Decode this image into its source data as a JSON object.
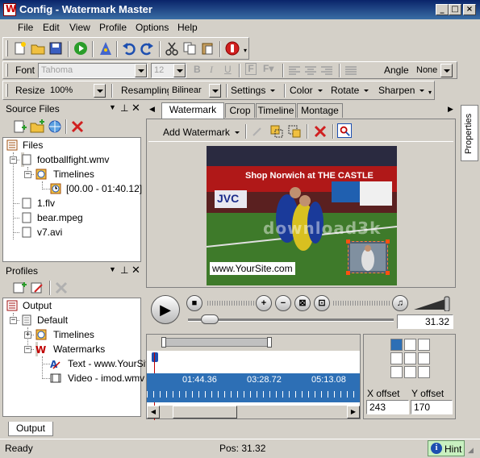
{
  "window": {
    "title": "Config - Watermark Master"
  },
  "menu": [
    "File",
    "Edit",
    "View",
    "Profile",
    "Options",
    "Help"
  ],
  "format_toolbar": {
    "font_label": "Font",
    "font_value": "Tahoma",
    "size_value": "12",
    "angle_label": "Angle",
    "angle_value": "None"
  },
  "process_toolbar": {
    "resize_label": "Resize",
    "resize_value": "100%",
    "resampling_label": "Resampling",
    "resampling_value": "Bilinear",
    "settings_label": "Settings",
    "color_label": "Color",
    "rotate_label": "Rotate",
    "sharpen_label": "Sharpen"
  },
  "source_files": {
    "title": "Source Files",
    "root": "Files",
    "items": {
      "football": "footballfight.wmv",
      "timelines": "Timelines",
      "range": "[00.00 - 01:40.12]",
      "flv": "1.flv",
      "mpeg": "bear.mpeg",
      "avi": "v7.avi"
    }
  },
  "profiles": {
    "title": "Profiles",
    "root": "Output",
    "default": "Default",
    "timelines": "Timelines",
    "watermarks": "Watermarks",
    "text_wm": "Text - www.YourSit",
    "video_wm": "Video - imod.wmv"
  },
  "tabs": [
    "Watermark",
    "Crop",
    "Timeline",
    "Montage"
  ],
  "properties_tab": "Properties",
  "add_watermark_label": "Add Watermark",
  "preview": {
    "banner_text": "Shop Norwich at THE CASTLE",
    "sponsor_text": "JVC",
    "site_label": "www.YourSite.com",
    "overlay_text": "download3k"
  },
  "player": {
    "time": "31.32"
  },
  "timeline": {
    "marks": [
      "01:44.36",
      "03:28.72",
      "05:13.08"
    ]
  },
  "position": {
    "x_label": "X offset",
    "y_label": "Y offset",
    "x_value": "243",
    "y_value": "170",
    "selected_cell": 0
  },
  "bottom_tab": "Output",
  "status": {
    "left": "Ready",
    "pos": "Pos: 31.32",
    "hint": "Hint"
  },
  "colors": {
    "title_start": "#0a246a",
    "title_end": "#3a6ea5",
    "timeline_blue": "#2d6fb5",
    "accent_red": "#c00000"
  }
}
